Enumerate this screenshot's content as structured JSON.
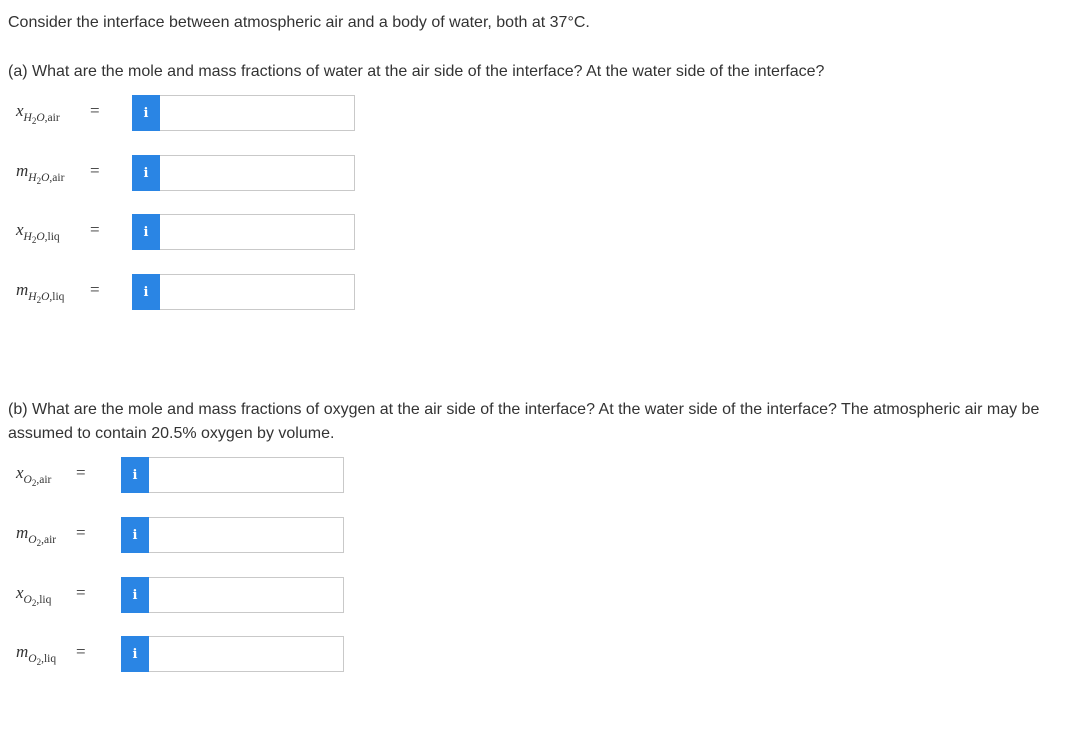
{
  "intro": "Consider the interface between atmospheric air and a body of water, both at 37°C.",
  "part_a": {
    "question": "(a) What are the mole and mass fractions of water at the air side of the interface? At the water side of the interface?",
    "fields": [
      {
        "var": "x",
        "species": "H",
        "sub2": "2",
        "species2": "O",
        "phase": ",air",
        "eq": "=",
        "info": "i",
        "value": ""
      },
      {
        "var": "m",
        "species": "H",
        "sub2": "2",
        "species2": "O",
        "phase": ",air",
        "eq": "=",
        "info": "i",
        "value": ""
      },
      {
        "var": "x",
        "species": "H",
        "sub2": "2",
        "species2": "O",
        "phase": ",liq",
        "eq": "=",
        "info": "i",
        "value": ""
      },
      {
        "var": "m",
        "species": "H",
        "sub2": "2",
        "species2": "O",
        "phase": ",liq",
        "eq": "=",
        "info": "i",
        "value": ""
      }
    ]
  },
  "part_b": {
    "question": "(b) What are the mole and mass fractions of oxygen at the air side of the interface? At the water side of the interface? The atmospheric air may be assumed to contain 20.5% oxygen by volume.",
    "fields": [
      {
        "var": "x",
        "species": "O",
        "sub2": "2",
        "phase": ",air",
        "eq": "=",
        "info": "i",
        "value": ""
      },
      {
        "var": "m",
        "species": "O",
        "sub2": "2",
        "phase": ",air",
        "eq": "=",
        "info": "i",
        "value": ""
      },
      {
        "var": "x",
        "species": "O",
        "sub2": "2",
        "phase": ",liq",
        "eq": "=",
        "info": "i",
        "value": ""
      },
      {
        "var": "m",
        "species": "O",
        "sub2": "2",
        "phase": ",liq",
        "eq": "=",
        "info": "i",
        "value": ""
      }
    ]
  },
  "colors": {
    "info_button": "#2a85e4",
    "text": "#333333",
    "input_border": "#c9c9c9"
  }
}
